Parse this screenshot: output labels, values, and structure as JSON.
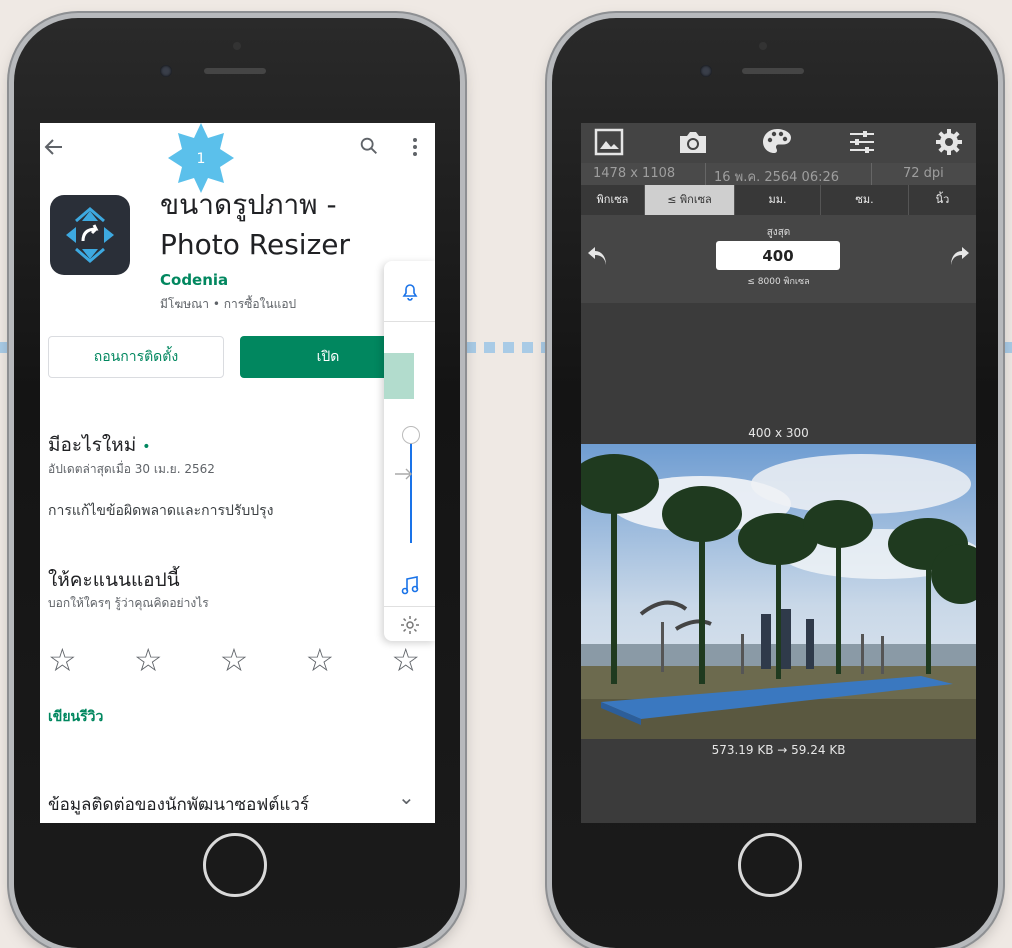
{
  "left_phone": {
    "step_badge": "1",
    "app_title_line1": "ขนาดรูปภาพ -",
    "app_title_line2": "Photo Resizer",
    "developer": "Codenia",
    "meta": "มีโฆษณา • การซื้อในแอป",
    "uninstall_label": "ถอนการติดตั้ง",
    "open_label": "เปิด",
    "whats_new_title": "มีอะไรใหม่",
    "whats_new_dot": "•",
    "updated": "อัปเดตล่าสุดเมื่อ 30 เม.ย. 2562",
    "changes": "การแก้ไขข้อผิดพลาดและการปรับปรุง",
    "rate_title": "ให้คะแนนแอปนี้",
    "rate_subtitle": "บอกให้ใครๆ รู้ว่าคุณคิดอย่างไร",
    "star_glyph": "☆",
    "rating_selected": 0,
    "write_review": "เขียนรีวิว",
    "contact_section": "ข้อมูลติดต่อของนักพัฒนาซอฟต์แวร์",
    "chevron": "⌄",
    "colors": {
      "brand_green": "#01875f",
      "badge_blue": "#5bc0eb"
    }
  },
  "right_phone": {
    "info": {
      "resolution": "1478 x 1108",
      "date": "16 พ.ค. 2564 06:26",
      "dpi": "72 dpi"
    },
    "units": [
      "พิกเซล",
      "≤ พิกเซล",
      "มม.",
      "ซม.",
      "นิ้ว"
    ],
    "selected_unit": "≤ พิกเซล",
    "max_label": "สูงสุด",
    "max_value": "400",
    "limit_text": "≤ 8000 พิกเซล",
    "output_dims": "400 x 300",
    "file_sizes": "573.19 KB → 59.24 KB",
    "toolbar_icons": [
      "gallery-icon",
      "camera-icon",
      "palette-icon",
      "sliders-icon",
      "settings-icon"
    ]
  }
}
